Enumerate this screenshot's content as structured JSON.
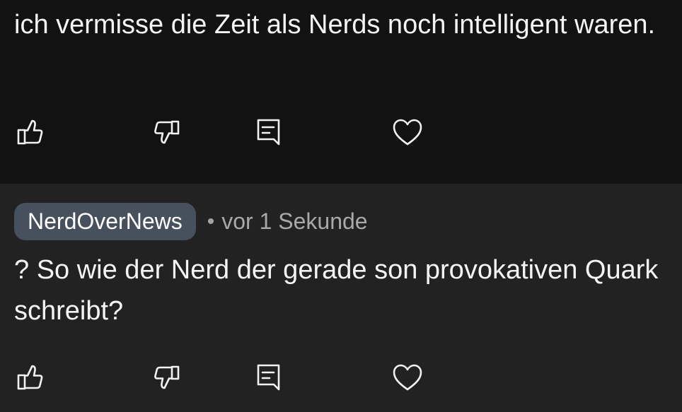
{
  "comments": [
    {
      "text": "ich vermisse die Zeit als Nerds noch intelligent waren.",
      "actions": {
        "like": "thumbs-up-icon",
        "dislike": "thumbs-down-icon",
        "reply": "comment-icon",
        "favorite": "heart-icon"
      }
    },
    {
      "author": "NerdOverNews",
      "separator": "•",
      "time": "vor 1 Sekunde",
      "text": "? So wie der Nerd der gerade son provokativen Quark schreibt?",
      "actions": {
        "like": "thumbs-up-icon",
        "dislike": "thumbs-down-icon",
        "reply": "comment-icon",
        "favorite": "heart-icon"
      }
    }
  ],
  "colors": {
    "background_primary": "#121212",
    "background_secondary": "#222222",
    "author_pill": "#47505d",
    "text": "#f4f4f4",
    "muted_text": "#a9a9a9"
  }
}
